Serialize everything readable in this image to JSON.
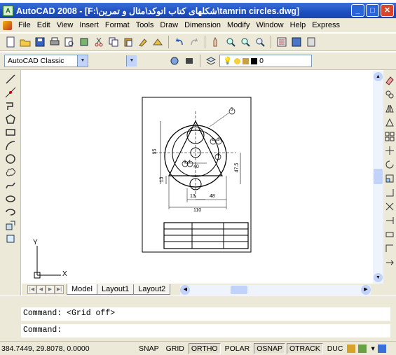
{
  "titlebar": {
    "title": "AutoCAD 2008 - [F:\\شکلهای کتاب اتوکد\\مثال و تمرین\\tamrin circles.dwg]",
    "minimize": "_",
    "maximize": "□",
    "close": "✕",
    "app_icon": "A"
  },
  "menubar": {
    "items": [
      "File",
      "Edit",
      "View",
      "Insert",
      "Format",
      "Tools",
      "Draw",
      "Dimension",
      "Modify",
      "Window",
      "Help",
      "Express"
    ]
  },
  "workspace": {
    "current": "AutoCAD Classic"
  },
  "layer": {
    "current": "0"
  },
  "tabs": [
    {
      "label": "Model"
    },
    {
      "label": "Layout1"
    },
    {
      "label": "Layout2"
    }
  ],
  "command": {
    "history": "Command:  <Grid off>",
    "prompt": "Command:"
  },
  "status": {
    "coordinates": "384.7449, 29.8078, 0.0000",
    "buttons": [
      {
        "label": "SNAP",
        "on": false
      },
      {
        "label": "GRID",
        "on": false
      },
      {
        "label": "ORTHO",
        "on": true
      },
      {
        "label": "POLAR",
        "on": false
      },
      {
        "label": "OSNAP",
        "on": true
      },
      {
        "label": "OTRACK",
        "on": true
      },
      {
        "label": "DUC",
        "on": false
      }
    ]
  },
  "drawing_text": {
    "ucs_x": "X",
    "ucs_y": "Y",
    "dim_95": "95",
    "dim_47_5": "47.5",
    "dim_13v": "13",
    "dim_40": "40",
    "dim_13h": "13",
    "dim_48": "48",
    "dim_110": "110",
    "b1": "1",
    "b2": "2",
    "b3": "3",
    "b4": "4",
    "b5": "5",
    "b6": "6"
  },
  "colors": {
    "title_blue": "#1d4fbf",
    "close_red": "#d8462a",
    "chrome": "#ece9d8"
  }
}
